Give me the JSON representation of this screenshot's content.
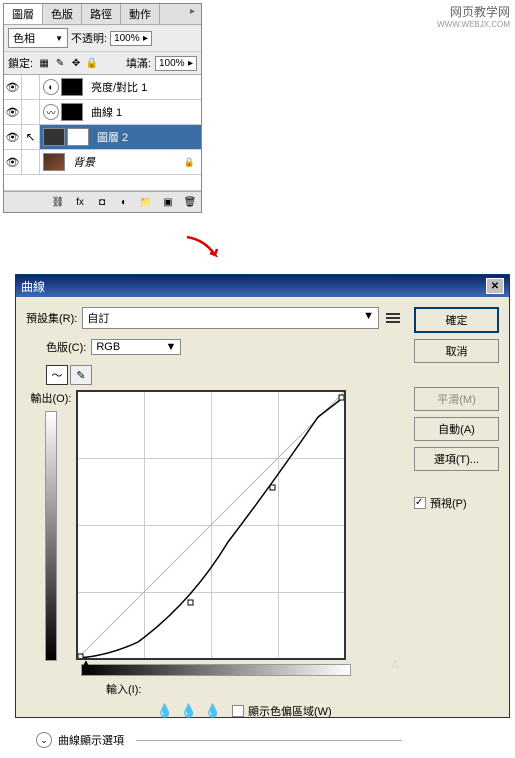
{
  "watermark": {
    "line1": "网页教学网",
    "line2": "WWW.WEBJX.COM"
  },
  "layers_panel": {
    "tabs": [
      "圖層",
      "色版",
      "路徑",
      "動作"
    ],
    "tab_close": "×",
    "blend_mode": "色相",
    "opacity_label": "不透明:",
    "opacity_value": "100%",
    "lock_label": "鎖定:",
    "fill_label": "填滿:",
    "fill_value": "100%",
    "layers": [
      {
        "name": "亮度/對比 1",
        "visible": true,
        "type": "adjustment",
        "selected": false
      },
      {
        "name": "曲線 1",
        "visible": true,
        "type": "adjustment",
        "selected": false
      },
      {
        "name": "圖層 2",
        "visible": true,
        "type": "normal",
        "selected": true
      },
      {
        "name": "背景",
        "visible": true,
        "type": "photo",
        "locked": true,
        "selected": false
      }
    ]
  },
  "curves_dialog": {
    "title": "曲線",
    "preset_label": "預設集(R):",
    "preset_value": "自訂",
    "channel_label": "色版(C):",
    "channel_value": "RGB",
    "output_label": "輸出(O):",
    "input_label": "輸入(I):",
    "show_clip_label": "顯示色偏區域(W)",
    "expand_label": "曲線顯示選項",
    "buttons": {
      "ok": "確定",
      "cancel": "取消",
      "smooth": "平滑(M)",
      "auto": "自動(A)",
      "options": "選項(T)..."
    },
    "preview_label": "預視(P)"
  },
  "chart_data": {
    "type": "line",
    "title": "曲線",
    "xlabel": "輸入(I)",
    "ylabel": "輸出(O)",
    "xlim": [
      0,
      255
    ],
    "ylim": [
      0,
      255
    ],
    "series": [
      {
        "name": "baseline",
        "x": [
          0,
          255
        ],
        "y": [
          0,
          255
        ]
      },
      {
        "name": "curve",
        "x": [
          0,
          30,
          108,
          187,
          255
        ],
        "y": [
          0,
          5,
          53,
          168,
          250
        ]
      }
    ]
  }
}
